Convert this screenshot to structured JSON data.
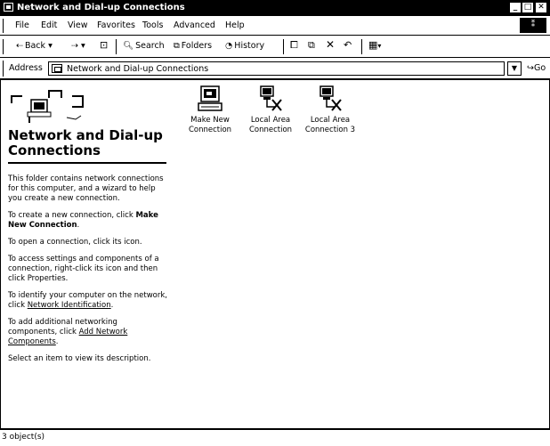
{
  "window": {
    "title": "Network and Dial-up Connections"
  },
  "menu": {
    "items": [
      {
        "label": "File"
      },
      {
        "label": "Edit"
      },
      {
        "label": "View"
      },
      {
        "label": "Favorites"
      },
      {
        "label": "Tools"
      },
      {
        "label": "Advanced"
      },
      {
        "label": "Help"
      }
    ]
  },
  "toolbar": {
    "back_label": "Back",
    "search_label": "Search",
    "folders_label": "Folders",
    "history_label": "History"
  },
  "address": {
    "label": "Address",
    "value": "Network and Dial-up Connections",
    "go_label": "Go"
  },
  "left_pane": {
    "title": "Network and Dial-up Connections",
    "p1": "This folder contains network connections for this computer, and a wizard to help you create a new connection.",
    "p2_text": "To create a new connection, click",
    "p2_bold": "Make New Connection",
    "p3": "To open a connection, click its icon.",
    "p4": "To access settings and components of a connection, right-click its icon and then click Properties.",
    "p5_text": "To identify your computer on the network, click",
    "p5_link": "Network Identification",
    "p6_text": "To add additional networking components, click",
    "p6_link": "Add Network Components",
    "p7": "Select an item to view its description."
  },
  "icons": [
    {
      "label": "Make New Connection",
      "icon": "make-new-connection-icon"
    },
    {
      "label": "Local Area Connection",
      "icon": "local-area-connection-icon"
    },
    {
      "label": "Local Area Connection 3",
      "icon": "local-area-connection-icon"
    }
  ],
  "status": {
    "text": "3 object(s)"
  }
}
